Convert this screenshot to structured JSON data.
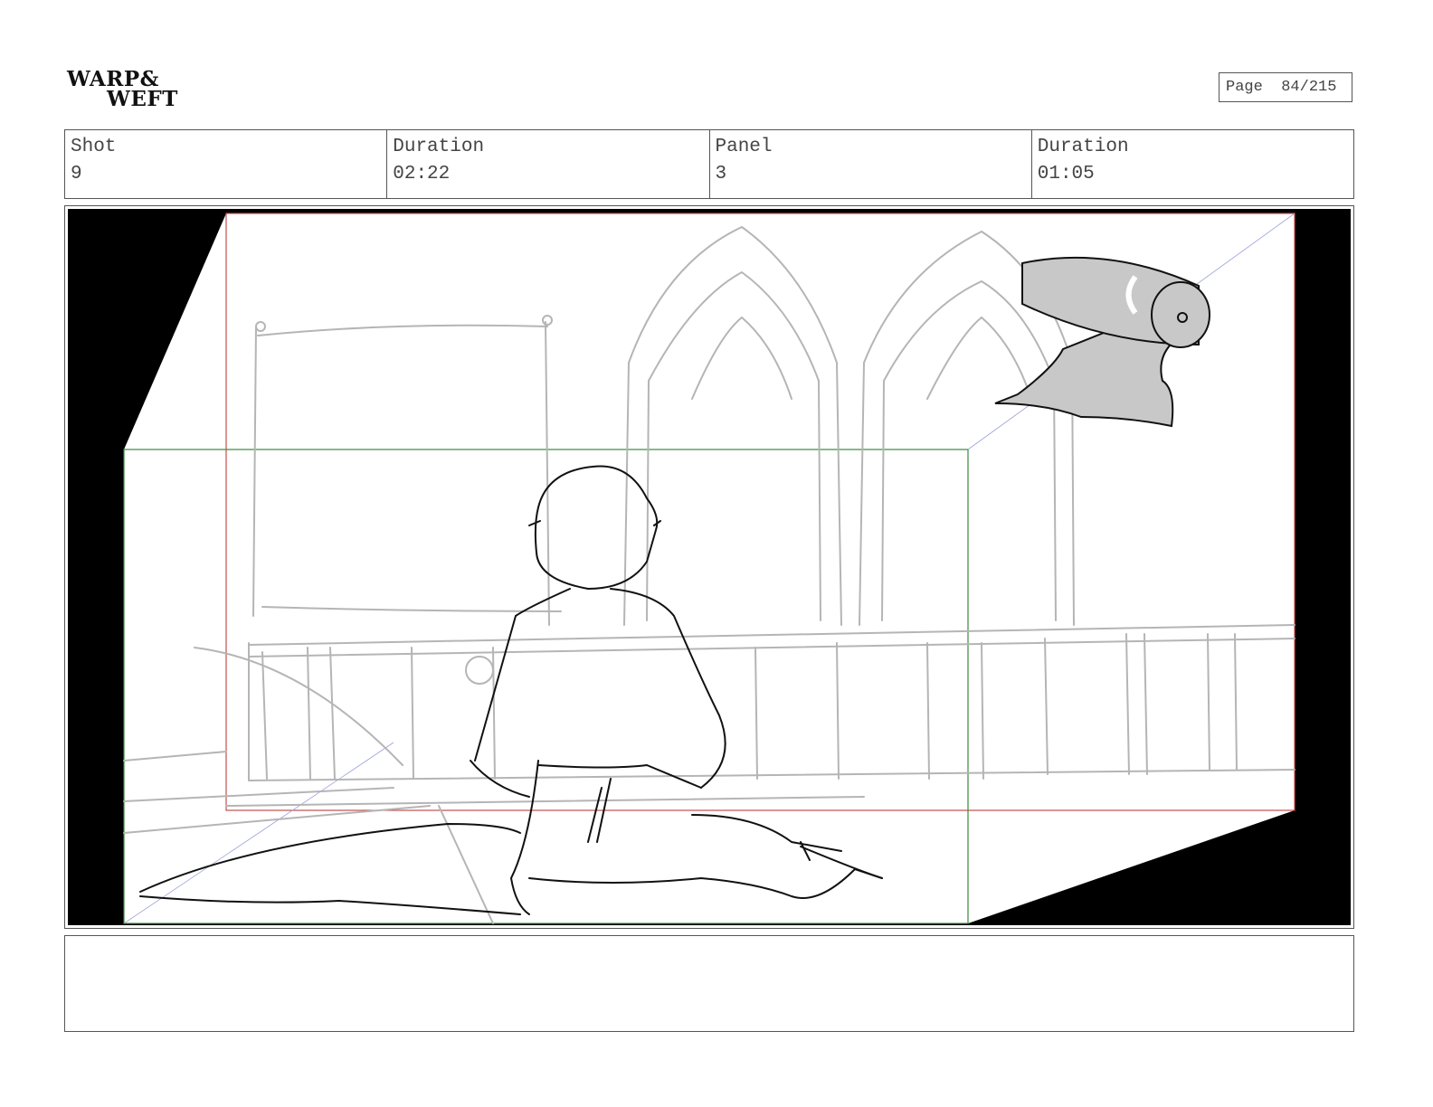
{
  "logo": {
    "line1": "WARP&",
    "line2": "WEFT"
  },
  "page": {
    "label": "Page",
    "current": "84",
    "total": "215",
    "display": "84/215"
  },
  "info": [
    {
      "label": "Shot",
      "value": "9"
    },
    {
      "label": "Duration",
      "value": "02:22"
    },
    {
      "label": "Panel",
      "value": "3"
    },
    {
      "label": "Duration",
      "value": "01:05"
    }
  ],
  "notes": ""
}
